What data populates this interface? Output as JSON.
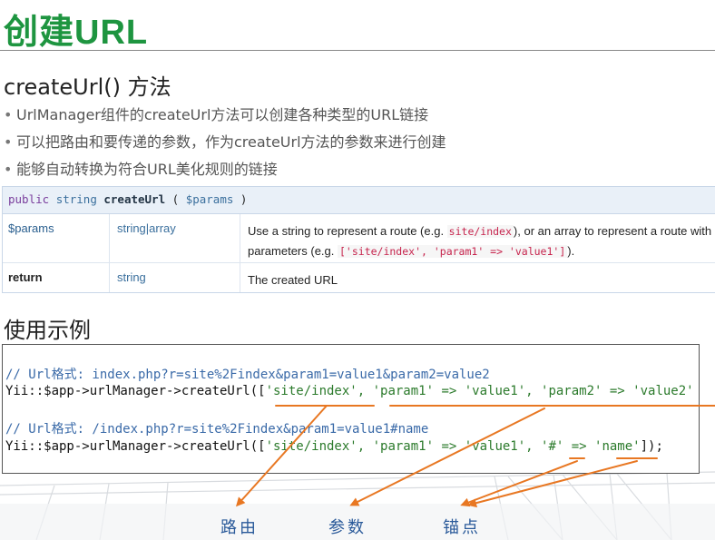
{
  "slide": {
    "title": "创建URL",
    "method_heading": "createUrl() 方法",
    "bullets": [
      "UrlManager组件的createUrl方法可以创建各种类型的URL链接",
      "可以把路由和要传递的参数，作为createUrl方法的参数来进行创建",
      "能够自动转换为符合URL美化规则的链接"
    ],
    "example_heading": "使用示例"
  },
  "api_table": {
    "signature": {
      "kw1": "public",
      "kw2": "string",
      "name": "createUrl",
      "open": "(",
      "param": "$params",
      "close": ")"
    },
    "rows": [
      {
        "name": "$params",
        "type": "string|array",
        "desc_part1": "Use a string to represent a route (e.g. ",
        "code1": "site/index",
        "desc_part2": "), or an array to represent a route with",
        "desc_part3": "parameters (e.g. ",
        "code2": "['site/index', 'param1' => 'value1']",
        "desc_part4": ")."
      },
      {
        "name": "return",
        "type": "string",
        "desc": "The created URL"
      }
    ]
  },
  "code_example": {
    "comment1": "// Url格式: index.php?r=site%2Findex&param1=value1&param2=value2",
    "line1_prefix": "Yii::$app->urlManager->createUrl([",
    "line1_args": "'site/index', 'param1' => 'value1', 'param2' => 'value2'",
    "comment2": "// Url格式: /index.php?r=site%2Findex&param1=value1#name",
    "line2_prefix": "Yii::$app->urlManager->createUrl([",
    "line2_args": "'site/index', 'param1' => 'value1', '#' => 'name'",
    "line2_suffix": "]);"
  },
  "annotations": {
    "route": "路由",
    "params": "参数",
    "anchor": "锚点",
    "arrow_color": "#e87722"
  },
  "colors": {
    "title_green": "#1e9540",
    "annotation_orange": "#e87722"
  }
}
